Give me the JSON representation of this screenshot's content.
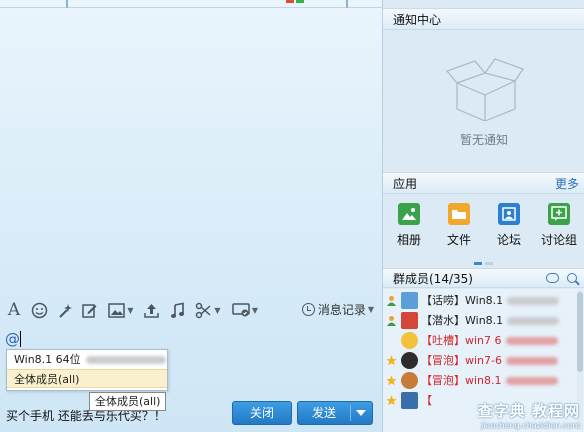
{
  "window": {
    "accent": "#2b82cc"
  },
  "toolbar": {
    "icons": [
      "font-icon",
      "emoji-icon",
      "magic-icon",
      "edit-icon",
      "image-icon",
      "upload-icon",
      "music-icon",
      "scissors-icon",
      "screen-icon"
    ],
    "history_label": "消息记录"
  },
  "input": {
    "at_text": "@",
    "typed_text": "买个手机 还能丢与乐代买？！"
  },
  "mention_popup": {
    "items": [
      {
        "label": "Win8.1 64位"
      },
      {
        "label": "全体成员(all)"
      }
    ],
    "tooltip": "全体成员(all)"
  },
  "buttons": {
    "close_label": "关闭",
    "send_label": "发送"
  },
  "notice_center": {
    "title": "通知中心",
    "empty_text": "暂无通知"
  },
  "apps": {
    "title": "应用",
    "more_label": "更多",
    "items": [
      {
        "label": "相册",
        "icon": "photo-album-icon",
        "color": "#3aa24a"
      },
      {
        "label": "文件",
        "icon": "folder-icon",
        "color": "#f0a92a"
      },
      {
        "label": "论坛",
        "icon": "forum-icon",
        "color": "#2c7fd1"
      },
      {
        "label": "讨论组",
        "icon": "discussion-icon",
        "color": "#3aa24a"
      }
    ]
  },
  "members": {
    "title": "群成员(14/35)",
    "list": [
      {
        "tag": "【话唠】",
        "name": "Win8.1",
        "color": "#111111"
      },
      {
        "tag": "【潜水】",
        "name": "Win8.1",
        "color": "#111111"
      },
      {
        "tag": "【吐槽】",
        "name": "win7 6",
        "color": "#d2262b"
      },
      {
        "tag": "【冒泡】",
        "name": "win7-6",
        "color": "#d2262b"
      },
      {
        "tag": "【冒泡】",
        "name": "win8.1",
        "color": "#d2262b"
      },
      {
        "tag": "【",
        "name": "",
        "color": "#d2262b"
      }
    ]
  },
  "watermark": {
    "line1": "查字典 教程网",
    "line2": "jiaocheng.chazidian.com"
  }
}
